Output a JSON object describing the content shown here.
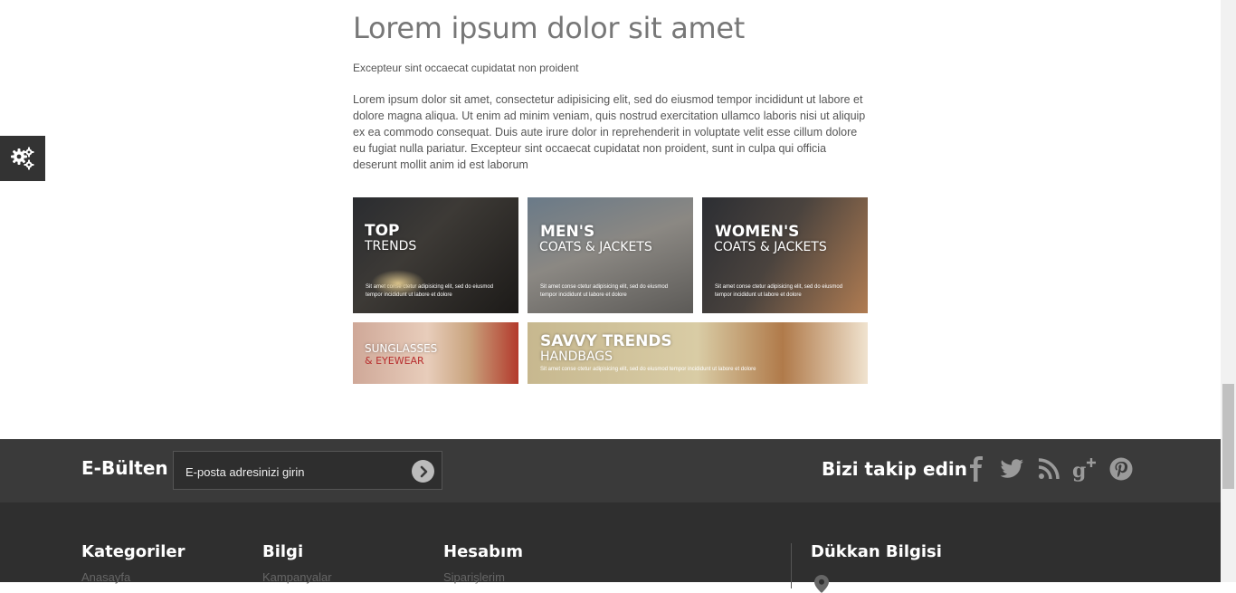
{
  "article": {
    "title": "Lorem ipsum dolor sit amet",
    "subtitle": "Excepteur sint occaecat cupidatat non proident",
    "body": "Lorem ipsum dolor sit amet, consectetur adipisicing elit, sed do eiusmod tempor incididunt ut labore et dolore magna aliqua. Ut enim ad minim veniam, quis nostrud exercitation ullamco laboris nisi ut aliquip ex ea commodo consequat. Duis aute irure dolor in reprehenderit in voluptate velit esse cillum dolore eu fugiat nulla pariatur. Excepteur sint occaecat cupidatat non proident, sunt in culpa qui officia deserunt mollit anim id est laborum"
  },
  "banners": [
    {
      "line1": "TOP",
      "line2": "TRENDS",
      "caption": "Sit amet conse ctetur adipisicing elit, sed do eiusmod tempor incididunt ut labore et dolore"
    },
    {
      "line1": "MEN'S",
      "line2": "COATS & JACKETS",
      "caption": "Sit amet conse ctetur adipisicing elit, sed do eiusmod tempor incididunt ut labore et dolore"
    },
    {
      "line1": "WOMEN'S",
      "line2": "COATS & JACKETS",
      "caption": "Sit amet conse ctetur adipisicing elit, sed do eiusmod tempor incididunt ut labore et dolore"
    },
    {
      "line1": "SUNGLASSES",
      "line2": "& EYEWEAR"
    },
    {
      "line1": "SAVVY TRENDS",
      "line2": "HANDBAGS",
      "caption": "Sit amet conse ctetur adipisicing elit, sed do eiusmod tempor incididunt ut labore et dolore"
    }
  ],
  "settings": {
    "icon": "gears-icon"
  },
  "newsletter": {
    "title": "E-Bülten",
    "placeholder": "E-posta adresinizi girin",
    "submit_icon": "chevron-right-circle-icon"
  },
  "follow": {
    "title": "Bizi takip edin",
    "icons": [
      "facebook-icon",
      "twitter-icon",
      "rss-icon",
      "google-plus-icon",
      "pinterest-icon"
    ]
  },
  "footer": {
    "columns": [
      {
        "title": "Kategoriler",
        "first_link": "Anasayfa"
      },
      {
        "title": "Bilgi",
        "first_link": "Kampanyalar"
      },
      {
        "title": "Hesabım",
        "first_link": "Siparişlerim"
      },
      {
        "title": "Dükkan Bilgisi"
      }
    ]
  },
  "colors": {
    "newsletter_bg": "#3a3a3a",
    "footer_bg": "#2f2f2f",
    "social_icon": "#9a9a9a"
  }
}
